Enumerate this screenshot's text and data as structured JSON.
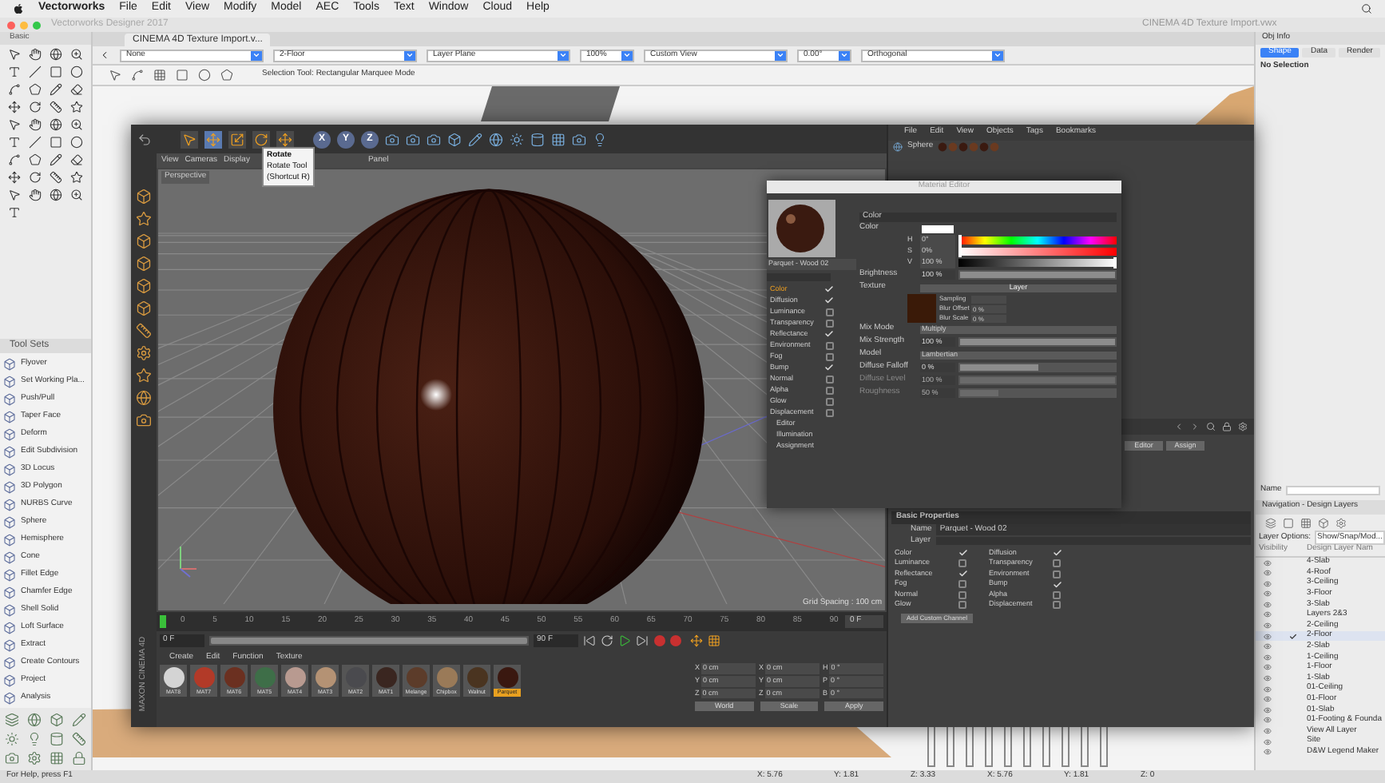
{
  "menu_bar": {
    "items": [
      "Vectorworks",
      "File",
      "Edit",
      "View",
      "Modify",
      "Model",
      "AEC",
      "Tools",
      "Text",
      "Window",
      "Cloud",
      "Help"
    ]
  },
  "window": {
    "app_title": "Vectorworks Designer 2017",
    "title": "CINEMA 4D Texture Import.vwx"
  },
  "basic_palette": {
    "title": "Basic"
  },
  "tool_sets": {
    "title": "Tool Sets",
    "items": [
      "Flyover",
      "Set Working Pla...",
      "Push/Pull",
      "Taper Face",
      "Deform",
      "Edit Subdivision",
      "3D Locus",
      "3D Polygon",
      "NURBS Curve",
      "Sphere",
      "Hemisphere",
      "Cone",
      "Fillet Edge",
      "Chamfer Edge",
      "Shell Solid",
      "Loft Surface",
      "Extract",
      "Create Contours",
      "Project",
      "Analysis"
    ]
  },
  "document_tab": "CINEMA 4D Texture Import.v...",
  "view_bar": [
    {
      "value": "None"
    },
    {
      "value": "2-Floor"
    },
    {
      "value": "Layer Plane"
    },
    {
      "value": "100%"
    },
    {
      "value": "Custom View"
    },
    {
      "value": "0.00°"
    },
    {
      "value": "Orthogonal"
    }
  ],
  "mode_bar": {
    "hint": "Selection Tool: Rectangular Marquee Mode"
  },
  "obj_info": {
    "title": "Obj Info",
    "tabs": [
      {
        "label": "Shape",
        "selected": true
      },
      {
        "label": "Data",
        "selected": false
      },
      {
        "label": "Render",
        "selected": false
      }
    ],
    "status": "No Selection"
  },
  "navigation": {
    "name_label": "Name",
    "title": "Navigation - Design Layers",
    "options_label": "Layer Options:",
    "options_value": "Show/Snap/Mod...",
    "columns": [
      "Visibility",
      "Design Layer Nam"
    ],
    "layers": [
      {
        "name": "4-Slab",
        "active": false
      },
      {
        "name": "4-Roof",
        "active": false
      },
      {
        "name": "3-Ceiling",
        "active": false
      },
      {
        "name": "3-Floor",
        "active": false
      },
      {
        "name": "3-Slab",
        "active": false
      },
      {
        "name": "Layers 2&3",
        "active": false
      },
      {
        "name": "2-Ceiling",
        "active": false
      },
      {
        "name": "2-Floor",
        "active": true
      },
      {
        "name": "2-Slab",
        "active": false
      },
      {
        "name": "1-Ceiling",
        "active": false
      },
      {
        "name": "1-Floor",
        "active": false
      },
      {
        "name": "1-Slab",
        "active": false
      },
      {
        "name": "01-Ceiling",
        "active": false
      },
      {
        "name": "01-Floor",
        "active": false
      },
      {
        "name": "01-Slab",
        "active": false
      },
      {
        "name": "01-Footing & Founda",
        "active": false
      },
      {
        "name": "View All Layer",
        "active": false
      },
      {
        "name": "Site",
        "active": false
      },
      {
        "name": "D&W Legend Maker",
        "active": false
      }
    ]
  },
  "cinema4d": {
    "axes": [
      "X",
      "Y",
      "Z"
    ],
    "tooltip": [
      "Rotate",
      "Rotate Tool",
      "(Shortcut R)"
    ],
    "viewport_menu": [
      "View",
      "Cameras",
      "Display",
      "Panel"
    ],
    "viewport_label": "Perspective",
    "grid_spacing": "Grid Spacing : 100 cm",
    "logo": "MAXON CINEMA 4D",
    "timeline": {
      "ticks": [
        "0",
        "5",
        "10",
        "15",
        "20",
        "25",
        "30",
        "35",
        "40",
        "45",
        "50",
        "55",
        "60",
        "65",
        "70",
        "75",
        "80",
        "85",
        "90"
      ],
      "current": "0 F"
    },
    "transport": {
      "start": "0 F",
      "end": "90 F",
      "level": 1
    },
    "material_manager": {
      "menu": [
        "Create",
        "Edit",
        "Function",
        "Texture"
      ],
      "materials": [
        {
          "name": "MAT8",
          "color": "#d4d4d4",
          "selected": false
        },
        {
          "name": "MAT7",
          "color": "#b23a28",
          "selected": false
        },
        {
          "name": "MAT6",
          "color": "#6b3020",
          "selected": false
        },
        {
          "name": "MAT5",
          "color": "#3e6e48",
          "selected": false
        },
        {
          "name": "MAT4",
          "color": "#b89a90",
          "selected": false
        },
        {
          "name": "MAT3",
          "color": "#b49274",
          "selected": false
        },
        {
          "name": "MAT2",
          "color": "#4a4a4e",
          "selected": false
        },
        {
          "name": "MAT1",
          "color": "#3a2620",
          "selected": false
        },
        {
          "name": "Melange",
          "color": "#5c3c2a",
          "selected": false
        },
        {
          "name": "Chipbox",
          "color": "#9a7a58",
          "selected": false
        },
        {
          "name": "Walnut",
          "color": "#4a3420",
          "selected": false
        },
        {
          "name": "Parquet",
          "color": "#3a1810",
          "selected": true
        }
      ]
    },
    "coordinates": {
      "rows": [
        {
          "p": "X",
          "pv": "0 cm",
          "s": "X",
          "sv": "0 cm",
          "r": "H",
          "rv": "0 °"
        },
        {
          "p": "Y",
          "pv": "0 cm",
          "s": "Y",
          "sv": "0 cm",
          "r": "P",
          "rv": "0 °"
        },
        {
          "p": "Z",
          "pv": "0 cm",
          "s": "Z",
          "sv": "0 cm",
          "r": "B",
          "rv": "0 °"
        }
      ],
      "buttons": [
        "World",
        "Scale",
        "Apply"
      ]
    },
    "object_manager": {
      "menu": [
        "File",
        "Edit",
        "View",
        "Objects",
        "Tags",
        "Bookmarks"
      ],
      "objects": [
        "Sphere"
      ]
    },
    "material_editor": {
      "title": "Material Editor",
      "material_name": "Parquet - Wood 02",
      "section": "Color",
      "channels": [
        {
          "label": "Color",
          "checked": true,
          "selected": true
        },
        {
          "label": "Diffusion",
          "checked": true,
          "selected": false
        },
        {
          "label": "Luminance",
          "checked": false,
          "selected": false
        },
        {
          "label": "Transparency",
          "checked": false,
          "selected": false
        },
        {
          "label": "Reflectance",
          "checked": true,
          "selected": false
        },
        {
          "label": "Environment",
          "checked": false,
          "selected": false
        },
        {
          "label": "Fog",
          "checked": false,
          "selected": false
        },
        {
          "label": "Bump",
          "checked": true,
          "selected": false
        },
        {
          "label": "Normal",
          "checked": false,
          "selected": false
        },
        {
          "label": "Alpha",
          "checked": false,
          "selected": false
        },
        {
          "label": "Glow",
          "checked": false,
          "selected": false
        },
        {
          "label": "Displacement",
          "checked": false,
          "selected": false
        }
      ],
      "pages": [
        "Editor",
        "Illumination",
        "Assignment"
      ],
      "rows": [
        {
          "kind": "color",
          "label": "Color"
        },
        {
          "kind": "hue",
          "label": "H",
          "value": "0°",
          "level": 0
        },
        {
          "kind": "saturation",
          "label": "S",
          "value": "0%",
          "level": 0
        },
        {
          "kind": "brightness",
          "label": "V",
          "value": "100 %",
          "level": 1
        },
        {
          "kind": "slider",
          "label": "Brightness",
          "value": "100 %",
          "level": 1,
          "disabled": false
        },
        {
          "kind": "texture",
          "label": "Texture",
          "value": "Layer",
          "sub": [
            {
              "label": "Sampling"
            },
            {
              "label": "Blur Offset",
              "value": "0 %"
            },
            {
              "label": "Blur Scale",
              "value": "0 %"
            }
          ]
        },
        {
          "kind": "dropdown",
          "label": "Mix Mode",
          "value": "Multiply"
        },
        {
          "kind": "slider",
          "label": "Mix Strength",
          "value": "100 %",
          "level": 1,
          "disabled": false
        },
        {
          "kind": "dropdown",
          "label": "Model",
          "value": "Lambertian"
        },
        {
          "kind": "slider",
          "label": "Diffuse Falloff",
          "value": "0 %",
          "level": 0.5,
          "disabled": false
        },
        {
          "kind": "slider",
          "label": "Diffuse Level",
          "value": "100 %",
          "level": 1,
          "disabled": true
        },
        {
          "kind": "slider",
          "label": "Roughness",
          "value": "50 %",
          "level": 0.25,
          "disabled": true
        }
      ]
    },
    "attribute_manager": {
      "buttons": [
        "Editor",
        "Assign"
      ],
      "section": "Basic Properties",
      "name_label": "Name",
      "name_value": "Parquet - Wood 02",
      "layer_label": "Layer",
      "add_button": "Add Custom Channel",
      "channels": [
        {
          "label": "Color",
          "checked": true
        },
        {
          "label": "Diffusion",
          "checked": true
        },
        {
          "label": "Luminance",
          "checked": false
        },
        {
          "label": "Transparency",
          "checked": false
        },
        {
          "label": "Reflectance",
          "checked": true
        },
        {
          "label": "Environment",
          "checked": false
        },
        {
          "label": "Fog",
          "checked": false
        },
        {
          "label": "Bump",
          "checked": true
        },
        {
          "label": "Normal",
          "checked": false
        },
        {
          "label": "Alpha",
          "checked": false
        },
        {
          "label": "Glow",
          "checked": false
        },
        {
          "label": "Displacement",
          "checked": false
        }
      ]
    }
  },
  "status_bar": {
    "help": "For Help, press F1",
    "coords": [
      "X: 5.76",
      "Y: 1.81",
      "Z: 3.33",
      "X: 5.76",
      "Y: 1.81",
      "Z: 0"
    ]
  }
}
